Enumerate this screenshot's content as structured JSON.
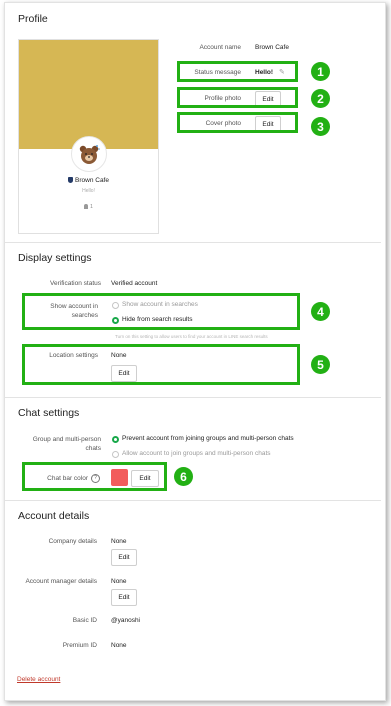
{
  "profile": {
    "title": "Profile",
    "display_name": "Brown Cafe",
    "status": "Hello!",
    "friends_count": "1",
    "account_name_label": "Account name",
    "account_name_value": "Brown Cafe",
    "status_message_label": "Status message",
    "status_message_value": "Hello!",
    "profile_photo_label": "Profile photo",
    "profile_photo_button": "Edit",
    "cover_photo_label": "Cover photo",
    "cover_photo_button": "Edit",
    "cover_color": "#d6b754"
  },
  "display_settings": {
    "title": "Display settings",
    "verification_label": "Verification status",
    "verification_value": "Verified account",
    "show_account_label_1": "Show account in",
    "show_account_label_2": "searches",
    "option_show": "Show account in searches",
    "option_hide": "Hide from search results",
    "option_hint": "Turn on this setting to allow users to find your account in LINE search results",
    "location_label": "Location settings",
    "location_value": "None",
    "location_button": "Edit"
  },
  "chat_settings": {
    "title": "Chat settings",
    "group_label_1": "Group and multi-person",
    "group_label_2": "chats",
    "option_prevent": "Prevent account from joining groups and multi-person chats",
    "option_allow": "Allow account to join groups and multi-person chats",
    "chat_bar_label": "Chat bar color",
    "chat_bar_color": "#f25c5c",
    "chat_bar_button": "Edit"
  },
  "account_details": {
    "title": "Account details",
    "company_label": "Company details",
    "company_value": "None",
    "company_button": "Edit",
    "manager_label": "Account manager details",
    "manager_value": "None",
    "manager_button": "Edit",
    "basic_id_label": "Basic ID",
    "basic_id_value": "@yanoshi",
    "premium_id_label": "Premium ID",
    "premium_id_value": "None"
  },
  "delete_account": "Delete account",
  "callouts": [
    "1",
    "2",
    "3",
    "4",
    "5",
    "6"
  ],
  "accent_color": "#22b014",
  "radio_color": "#18a84a"
}
